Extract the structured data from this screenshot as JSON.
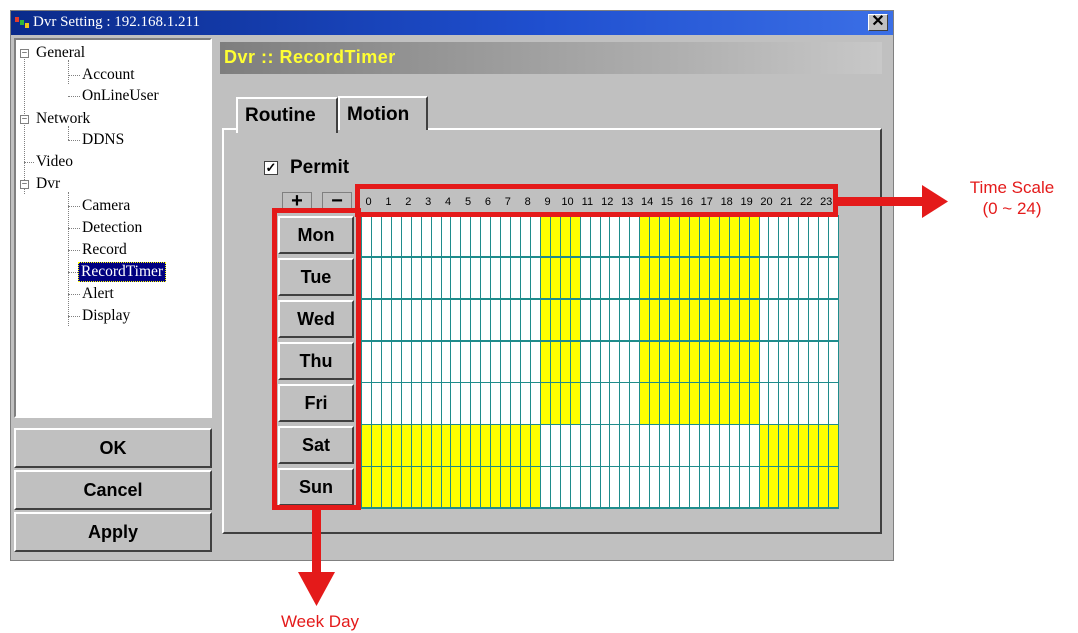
{
  "window": {
    "title": "Dvr Setting : 192.168.1.211",
    "close_label": "✕"
  },
  "tree": {
    "nodes": [
      {
        "label": "General",
        "expander": "−"
      },
      {
        "label": "Account"
      },
      {
        "label": "OnLineUser"
      },
      {
        "label": "Network",
        "expander": "−"
      },
      {
        "label": "DDNS"
      },
      {
        "label": "Video"
      },
      {
        "label": "Dvr",
        "expander": "−"
      },
      {
        "label": "Camera"
      },
      {
        "label": "Detection"
      },
      {
        "label": "Record"
      },
      {
        "label": "RecordTimer",
        "selected": true
      },
      {
        "label": "Alert"
      },
      {
        "label": "Display"
      }
    ]
  },
  "buttons": {
    "ok": "OK",
    "cancel": "Cancel",
    "apply": "Apply"
  },
  "header": {
    "title": "Dvr :: RecordTimer"
  },
  "tabs": [
    {
      "label": "Routine",
      "active": true
    },
    {
      "label": "Motion",
      "active": false
    }
  ],
  "permit": {
    "label": "Permit",
    "checked": true,
    "check_mark": "✓"
  },
  "zoom": {
    "plus": "+",
    "minus": "−"
  },
  "hours": [
    "0",
    "1",
    "2",
    "3",
    "4",
    "5",
    "6",
    "7",
    "8",
    "9",
    "10",
    "11",
    "12",
    "13",
    "14",
    "15",
    "16",
    "17",
    "18",
    "19",
    "20",
    "21",
    "22",
    "23"
  ],
  "days": [
    "Mon",
    "Tue",
    "Wed",
    "Thu",
    "Fri",
    "Sat",
    "Sun"
  ],
  "schedule": {
    "slots_per_hour": 2,
    "recording_color": "#ffff00",
    "idle_color": "#ffffff",
    "rows": [
      {
        "day": "Mon",
        "recorded_hours": [
          9,
          10,
          14,
          15,
          16,
          17,
          18,
          19
        ]
      },
      {
        "day": "Tue",
        "recorded_hours": [
          9,
          10,
          14,
          15,
          16,
          17,
          18,
          19
        ]
      },
      {
        "day": "Wed",
        "recorded_hours": [
          9,
          10,
          14,
          15,
          16,
          17,
          18,
          19
        ]
      },
      {
        "day": "Thu",
        "recorded_hours": [
          9,
          10,
          14,
          15,
          16,
          17,
          18,
          19
        ]
      },
      {
        "day": "Fri",
        "recorded_hours": [
          9,
          10,
          14,
          15,
          16,
          17,
          18,
          19
        ]
      },
      {
        "day": "Sat",
        "recorded_hours": [
          0,
          1,
          2,
          3,
          4,
          5,
          6,
          7,
          8,
          20,
          21,
          22,
          23
        ]
      },
      {
        "day": "Sun",
        "recorded_hours": [
          0,
          1,
          2,
          3,
          4,
          5,
          6,
          7,
          8,
          20,
          21,
          22,
          23
        ]
      }
    ]
  },
  "annotations": {
    "time_scale_line1": "Time Scale",
    "time_scale_line2": "(0 ~ 24)",
    "week_day": "Week Day",
    "color": "#e41a1a"
  },
  "colors": {
    "title_bar": "#1f4fcf",
    "header_text": "#ffff33",
    "grid_line": "#1f8c8c",
    "selected_node": "#000080"
  }
}
